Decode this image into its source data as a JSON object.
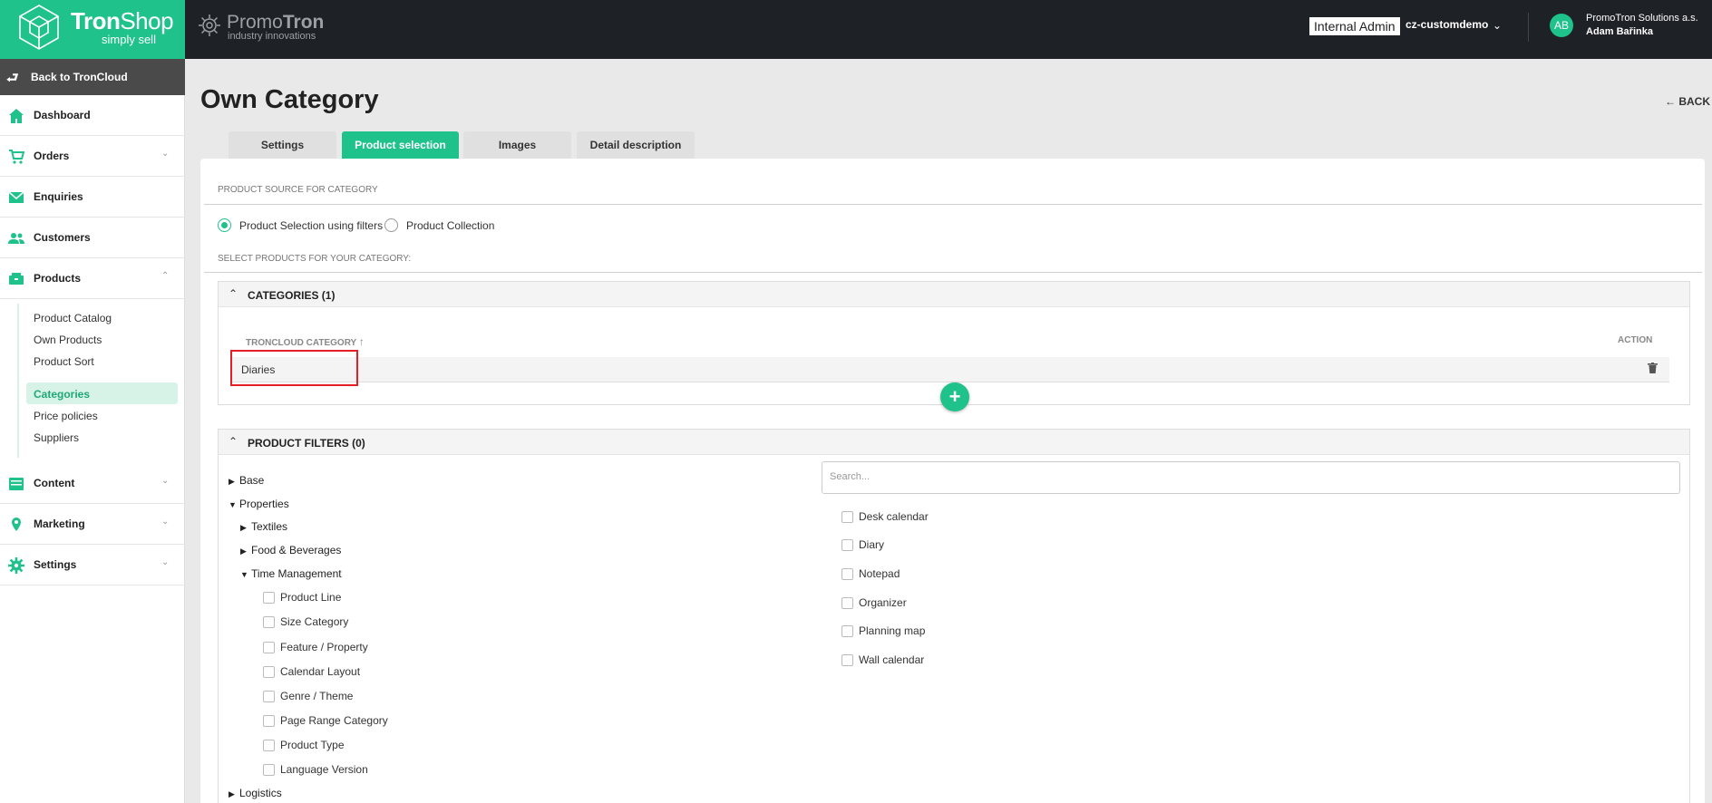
{
  "brand": {
    "name_bold": "Tron",
    "name_light": "Shop",
    "tagline": "simply sell"
  },
  "partner": {
    "name_light": "Promo",
    "name_bold": "Tron",
    "tagline": "industry innovations"
  },
  "header": {
    "role_badge": "Internal Admin",
    "tenant": "cz-customdemo",
    "avatar_initials": "AB",
    "company": "PromoTron Solutions a.s.",
    "user": "Adam Bařinka"
  },
  "sidebar": {
    "back": "Back to TronCloud",
    "items": [
      {
        "label": "Dashboard",
        "icon": "home-icon"
      },
      {
        "label": "Orders",
        "icon": "cart-icon"
      },
      {
        "label": "Enquiries",
        "icon": "mail-icon"
      },
      {
        "label": "Customers",
        "icon": "users-icon"
      },
      {
        "label": "Products",
        "icon": "box-icon"
      },
      {
        "label": "Content",
        "icon": "content-icon"
      },
      {
        "label": "Marketing",
        "icon": "pin-icon"
      },
      {
        "label": "Settings",
        "icon": "gear-icon"
      }
    ],
    "product_sub": [
      "Product Catalog",
      "Own Products",
      "Product Sort",
      "Categories",
      "Price policies",
      "Suppliers"
    ],
    "active_sub": "Categories"
  },
  "page": {
    "title": "Own Category",
    "back": "BACK",
    "tabs": [
      "Settings",
      "Product selection",
      "Images",
      "Detail description"
    ],
    "active_tab": "Product selection"
  },
  "source": {
    "label": "PRODUCT SOURCE FOR CATEGORY",
    "options": [
      "Product Selection using filters",
      "Product Collection"
    ],
    "selected": "Product Selection using filters",
    "select_label": "SELECT PRODUCTS FOR YOUR CATEGORY:"
  },
  "categories_panel": {
    "title": "CATEGORIES (1)",
    "col_category": "TRONCLOUD CATEGORY",
    "sort_indicator": "↑",
    "col_action": "ACTION",
    "rows": [
      "Diaries"
    ],
    "add_label": "+"
  },
  "filters_panel": {
    "title": "PRODUCT FILTERS (0)",
    "search_placeholder": "Search...",
    "tree": {
      "base": "Base",
      "properties": "Properties",
      "textiles": "Textiles",
      "food": "Food & Beverages",
      "time": "Time Management",
      "time_children": [
        "Product Line",
        "Size Category",
        "Feature / Property",
        "Calendar Layout",
        "Genre / Theme",
        "Page Range Category",
        "Product Type",
        "Language Version"
      ],
      "logistics": "Logistics"
    },
    "values": [
      "Desk calendar",
      "Diary",
      "Notepad",
      "Organizer",
      "Planning map",
      "Wall calendar"
    ]
  },
  "colors": {
    "accent": "#1fc28b",
    "topbar": "#1e2125",
    "highlight": "#e61e25"
  }
}
